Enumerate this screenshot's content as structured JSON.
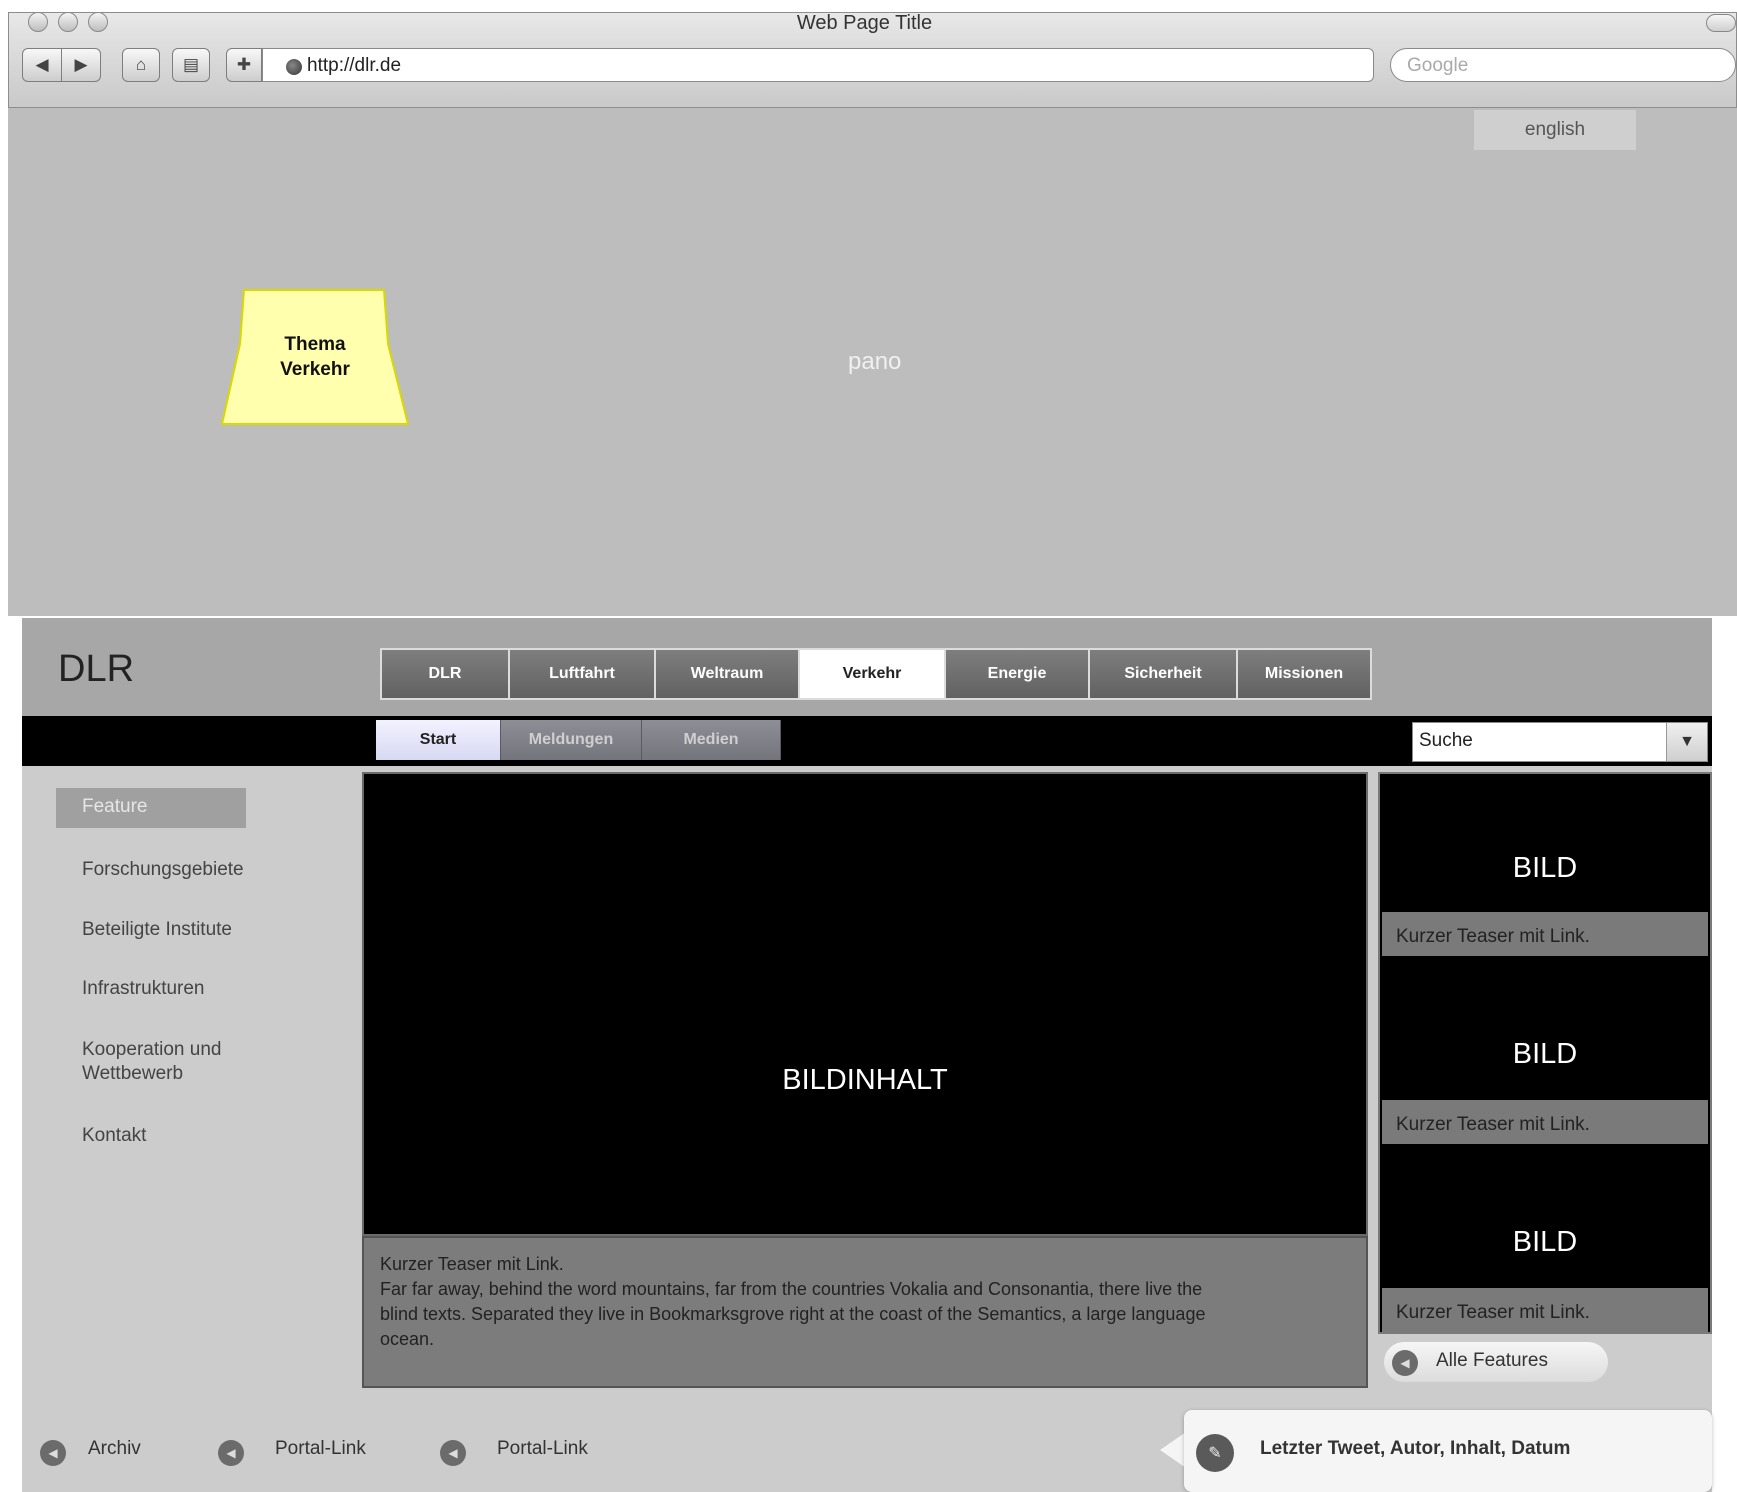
{
  "window": {
    "title": "Web Page Title"
  },
  "toolbar": {
    "back_icon": "◀",
    "forward_icon": "▶",
    "home_icon": "⌂",
    "print_icon": "▤",
    "add_icon": "✚",
    "url": "http://dlr.de",
    "search_placeholder": "Google"
  },
  "pano": {
    "language_button": "english",
    "label": "pano",
    "sticky_line1": "Thema",
    "sticky_line2": "Verkehr"
  },
  "site": {
    "logo": "DLR",
    "main_nav": [
      {
        "label": "DLR",
        "active": false
      },
      {
        "label": "Luftfahrt",
        "active": false
      },
      {
        "label": "Weltraum",
        "active": false
      },
      {
        "label": "Verkehr",
        "active": true
      },
      {
        "label": "Energie",
        "active": false
      },
      {
        "label": "Sicherheit",
        "active": false
      },
      {
        "label": "Missionen",
        "active": false
      }
    ],
    "sub_nav": [
      {
        "label": "Start",
        "active": true
      },
      {
        "label": "Meldungen",
        "active": false
      },
      {
        "label": "Medien",
        "active": false
      }
    ],
    "search_value": "Suche",
    "search_dropdown_icon": "▼"
  },
  "sidebar": {
    "active_item": "Feature",
    "items": [
      {
        "label": "Forschungsgebiete"
      },
      {
        "label": "Beteiligte Institute"
      },
      {
        "label": "Infrastrukturen"
      },
      {
        "label": "Kooperation und",
        "label2": "Wettbewerb"
      },
      {
        "label": "Kontakt"
      }
    ]
  },
  "hero": {
    "image_label": "BILDINHALT",
    "teaser_title": "Kurzer Teaser mit Link.",
    "teaser_line1": "Far far away, behind the word mountains, far from the countries Vokalia and Consonantia, there live the",
    "teaser_line2": "blind texts. Separated they live in Bookmarksgrove right at the coast of the Semantics, a large language",
    "teaser_line3": "ocean."
  },
  "features": [
    {
      "image_label": "BILD",
      "teaser": "Kurzer Teaser mit Link."
    },
    {
      "image_label": "BILD",
      "teaser": "Kurzer Teaser mit Link."
    },
    {
      "image_label": "BILD",
      "teaser": "Kurzer Teaser mit Link."
    }
  ],
  "all_features_link": "Alle Features",
  "footer": {
    "links": [
      "Archiv",
      "Portal-Link",
      "Portal-Link"
    ],
    "tweet": "Letzter Tweet, Autor, Inhalt, Datum"
  },
  "colors": {
    "sticky_fill": "#ffffae",
    "sticky_stroke": "#d9d900",
    "header_gray": "#a7a7a7",
    "content_gray": "#cccccc"
  }
}
